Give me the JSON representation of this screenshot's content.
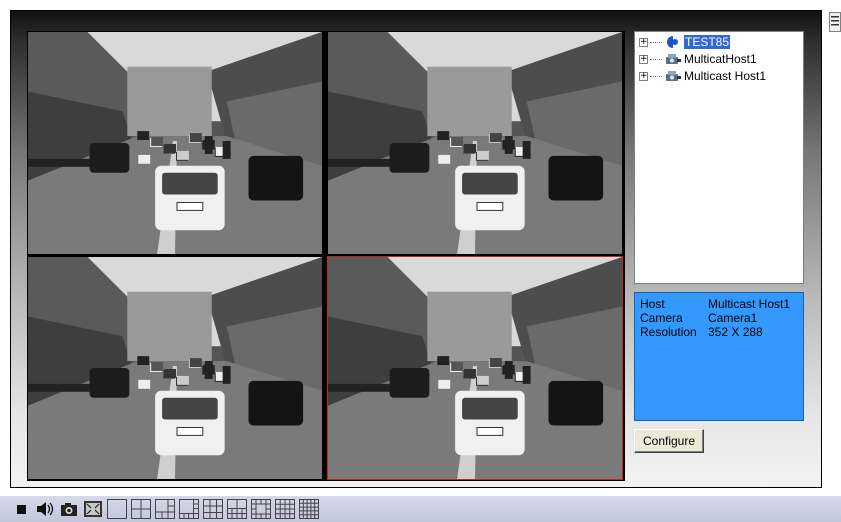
{
  "tree": {
    "items": [
      {
        "label": "TEST85",
        "icon": "server-globe-icon",
        "selected": true
      },
      {
        "label": "MulticatHost1",
        "icon": "host-camera-icon",
        "selected": false
      },
      {
        "label": "Multicast Host1",
        "icon": "host-camera-icon",
        "selected": false
      }
    ],
    "expander_glyph": "+"
  },
  "info": {
    "rows": [
      {
        "key": "Host",
        "value": "Multicast Host1"
      },
      {
        "key": "Camera",
        "value": "Camera1"
      },
      {
        "key": "Resolution",
        "value": "352 X 288"
      }
    ]
  },
  "configure_label": "Configure",
  "video": {
    "tiles": [
      {
        "name": "video-tile-1",
        "selected": false
      },
      {
        "name": "video-tile-2",
        "selected": false
      },
      {
        "name": "video-tile-3",
        "selected": false
      },
      {
        "name": "video-tile-4",
        "selected": true
      }
    ],
    "selected_border_color": "#cc1f1f"
  },
  "toolbar": {
    "buttons": [
      "stop-icon",
      "speaker-icon",
      "snapshot-icon",
      "fullscreen-icon",
      "layout-1-icon",
      "layout-4-icon",
      "layout-6-icon",
      "layout-8-icon",
      "layout-9-icon",
      "layout-10-icon",
      "layout-13-icon",
      "layout-16-icon",
      "layout-25-icon"
    ]
  },
  "colors": {
    "info_background": "#3399ff",
    "tree_selection": "#3168d5"
  }
}
